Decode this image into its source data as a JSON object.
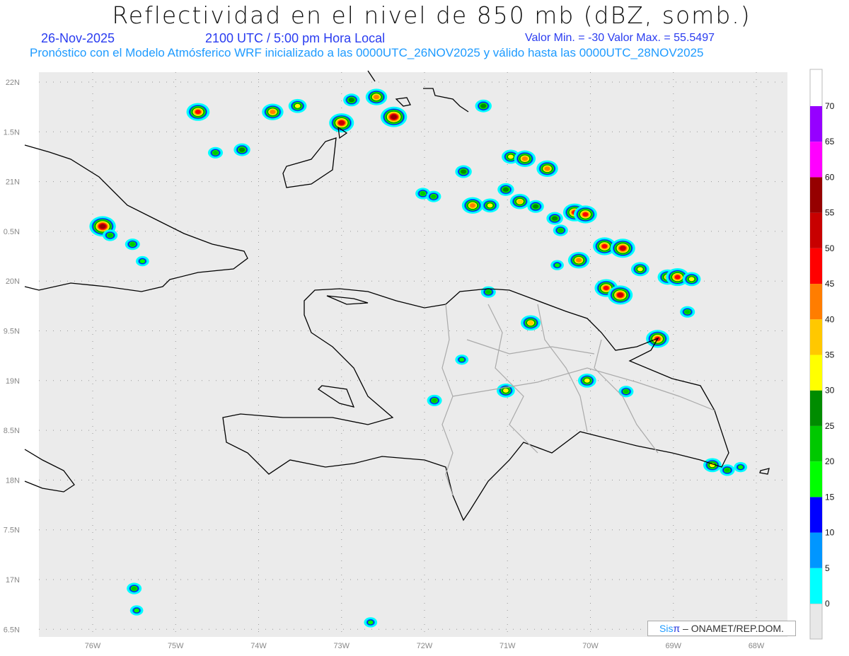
{
  "header": {
    "title": "Reflectividad en el nivel de 850 mb (dBZ, somb.)",
    "date": "26-Nov-2025",
    "time": "2100 UTC / 5:00 pm Hora Local",
    "minmax": "Valor Min. = -30  Valor Max. = 55.5497",
    "forecast": "Pronóstico con el Modelo Atmósferico WRF inicializado a las 0000UTC_26NOV2025 y válido hasta las  0000UTC_28NOV2025"
  },
  "credit": {
    "sis": "Sis",
    "pi": "π",
    "text": " – ONAMET/REP.DOM."
  },
  "chart_data": {
    "type": "heatmap",
    "variable": "Reflectividad 850 mb (dBZ)",
    "lon_ticks": [
      "76W",
      "75W",
      "74W",
      "73W",
      "72W",
      "71W",
      "70W",
      "69W",
      "68W"
    ],
    "lat_ticks": [
      "22N",
      "1.5N",
      "21N",
      "0.5N",
      "20N",
      "9.5N",
      "19N",
      "8.5N",
      "18N",
      "7.5N",
      "17N",
      "6.5N"
    ],
    "lon_range": [
      -76.65,
      -67.6
    ],
    "lat_range": [
      16.4,
      22.1
    ],
    "grid": true,
    "colorbar": {
      "labels": [
        "0",
        "5",
        "10",
        "15",
        "20",
        "25",
        "30",
        "35",
        "40",
        "45",
        "50",
        "55",
        "60",
        "65",
        "70"
      ],
      "colors": [
        "#00FFFF",
        "#0096FF",
        "#0000FF",
        "#00FF00",
        "#00C800",
        "#008C00",
        "#FFFF00",
        "#FFC800",
        "#FF7D00",
        "#FF0000",
        "#C80000",
        "#960000",
        "#FF00FF",
        "#9600FF"
      ]
    },
    "echoes": [
      {
        "lon": -74.73,
        "lat": 21.7,
        "dbz": 45
      },
      {
        "lon": -73.83,
        "lat": 21.7,
        "dbz": 40
      },
      {
        "lon": -73.53,
        "lat": 21.76,
        "dbz": 30
      },
      {
        "lon": -73.0,
        "lat": 21.59,
        "dbz": 50
      },
      {
        "lon": -72.88,
        "lat": 21.82,
        "dbz": 25
      },
      {
        "lon": -72.58,
        "lat": 21.85,
        "dbz": 40
      },
      {
        "lon": -72.37,
        "lat": 21.65,
        "dbz": 55
      },
      {
        "lon": -71.29,
        "lat": 21.76,
        "dbz": 25
      },
      {
        "lon": -74.52,
        "lat": 21.29,
        "dbz": 20
      },
      {
        "lon": -74.2,
        "lat": 21.32,
        "dbz": 25
      },
      {
        "lon": -75.88,
        "lat": 20.55,
        "dbz": 55
      },
      {
        "lon": -75.79,
        "lat": 20.46,
        "dbz": 20
      },
      {
        "lon": -75.52,
        "lat": 20.37,
        "dbz": 20
      },
      {
        "lon": -75.4,
        "lat": 20.2,
        "dbz": 15
      },
      {
        "lon": -71.53,
        "lat": 21.1,
        "dbz": 25
      },
      {
        "lon": -72.02,
        "lat": 20.88,
        "dbz": 20
      },
      {
        "lon": -71.89,
        "lat": 20.85,
        "dbz": 20
      },
      {
        "lon": -71.42,
        "lat": 20.76,
        "dbz": 40
      },
      {
        "lon": -71.21,
        "lat": 20.76,
        "dbz": 30
      },
      {
        "lon": -70.96,
        "lat": 21.25,
        "dbz": 30
      },
      {
        "lon": -70.79,
        "lat": 21.23,
        "dbz": 40
      },
      {
        "lon": -70.52,
        "lat": 21.13,
        "dbz": 40
      },
      {
        "lon": -71.02,
        "lat": 20.92,
        "dbz": 25
      },
      {
        "lon": -70.85,
        "lat": 20.8,
        "dbz": 35
      },
      {
        "lon": -70.66,
        "lat": 20.75,
        "dbz": 25
      },
      {
        "lon": -70.43,
        "lat": 20.63,
        "dbz": 25
      },
      {
        "lon": -70.19,
        "lat": 20.69,
        "dbz": 45
      },
      {
        "lon": -70.06,
        "lat": 20.67,
        "dbz": 45
      },
      {
        "lon": -70.36,
        "lat": 20.51,
        "dbz": 20
      },
      {
        "lon": -70.14,
        "lat": 20.21,
        "dbz": 40
      },
      {
        "lon": -70.4,
        "lat": 20.16,
        "dbz": 15
      },
      {
        "lon": -69.83,
        "lat": 20.35,
        "dbz": 45
      },
      {
        "lon": -69.61,
        "lat": 20.33,
        "dbz": 50
      },
      {
        "lon": -69.4,
        "lat": 20.12,
        "dbz": 30
      },
      {
        "lon": -69.07,
        "lat": 20.04,
        "dbz": 35
      },
      {
        "lon": -68.95,
        "lat": 20.04,
        "dbz": 45
      },
      {
        "lon": -68.78,
        "lat": 20.02,
        "dbz": 30
      },
      {
        "lon": -69.81,
        "lat": 19.93,
        "dbz": 45
      },
      {
        "lon": -69.64,
        "lat": 19.86,
        "dbz": 50
      },
      {
        "lon": -68.83,
        "lat": 19.69,
        "dbz": 20
      },
      {
        "lon": -69.19,
        "lat": 19.42,
        "dbz": 45
      },
      {
        "lon": -70.72,
        "lat": 19.58,
        "dbz": 35
      },
      {
        "lon": -71.23,
        "lat": 19.89,
        "dbz": 20
      },
      {
        "lon": -71.55,
        "lat": 19.21,
        "dbz": 15
      },
      {
        "lon": -71.02,
        "lat": 18.9,
        "dbz": 30
      },
      {
        "lon": -70.04,
        "lat": 19.0,
        "dbz": 30
      },
      {
        "lon": -69.57,
        "lat": 18.89,
        "dbz": 20
      },
      {
        "lon": -71.88,
        "lat": 18.8,
        "dbz": 20
      },
      {
        "lon": -68.53,
        "lat": 18.15,
        "dbz": 30
      },
      {
        "lon": -68.35,
        "lat": 18.1,
        "dbz": 20
      },
      {
        "lon": -68.19,
        "lat": 18.13,
        "dbz": 15
      },
      {
        "lon": -75.5,
        "lat": 16.91,
        "dbz": 20
      },
      {
        "lon": -75.47,
        "lat": 16.69,
        "dbz": 15
      },
      {
        "lon": -72.65,
        "lat": 16.57,
        "dbz": 15
      }
    ]
  }
}
